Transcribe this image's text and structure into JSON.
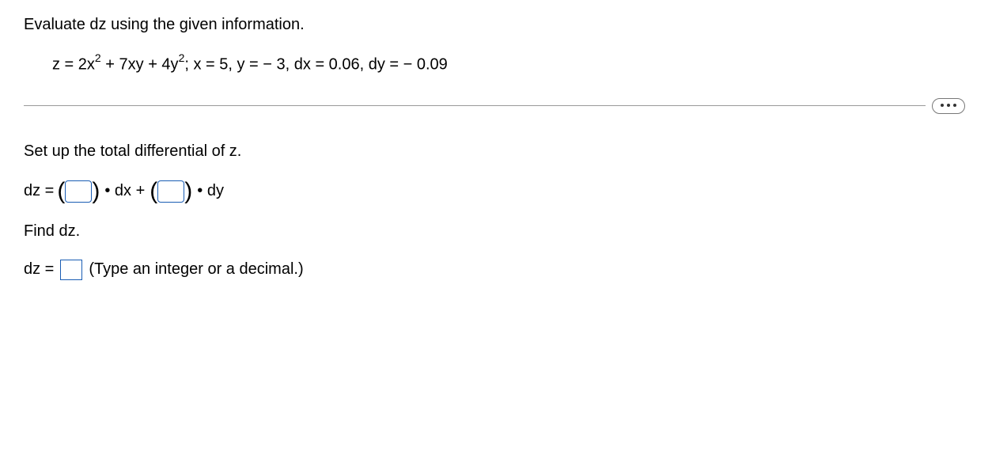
{
  "prompt": "Evaluate dz using the given information.",
  "equation": {
    "z_prefix": "z = 2x",
    "exp1": "2",
    "mid1": " + 7xy + 4y",
    "exp2": "2",
    "sep": "; x = 5, y = − 3, dx = 0.06, dy = − 0.09"
  },
  "setup": "Set up the total differential of z.",
  "diff": {
    "prefix": "dz =",
    "lparen": "(",
    "rparen": ")",
    "dot_dx": "• dx +",
    "dot_dy": "• dy"
  },
  "find": "Find dz.",
  "answer": {
    "prefix": "dz  =",
    "hint": "(Type an integer or a decimal.)"
  }
}
